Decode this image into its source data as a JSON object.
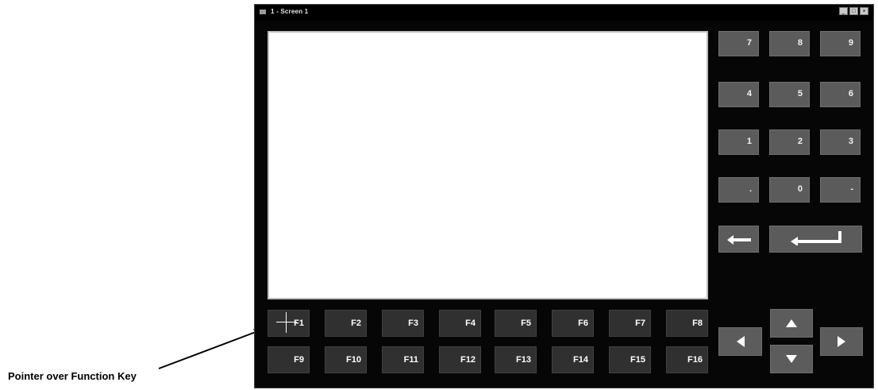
{
  "window": {
    "title": "1 - Screen 1",
    "controls": [
      "_",
      "□",
      "×"
    ]
  },
  "keypad": {
    "keys": [
      "7",
      "8",
      "9",
      "4",
      "5",
      "6",
      "1",
      "2",
      "3",
      ".",
      "0",
      "-"
    ],
    "backspace_icon": "left-arrow-icon",
    "enter_icon": "enter-return-icon"
  },
  "function_keys": [
    "F1",
    "F2",
    "F3",
    "F4",
    "F5",
    "F6",
    "F7",
    "F8",
    "F9",
    "F10",
    "F11",
    "F12",
    "F13",
    "F14",
    "F15",
    "F16"
  ],
  "arrow_keys": [
    "up-arrow-icon",
    "left-arrow-icon",
    "down-arrow-icon",
    "right-arrow-icon"
  ],
  "caption": "Pointer over Function Key"
}
